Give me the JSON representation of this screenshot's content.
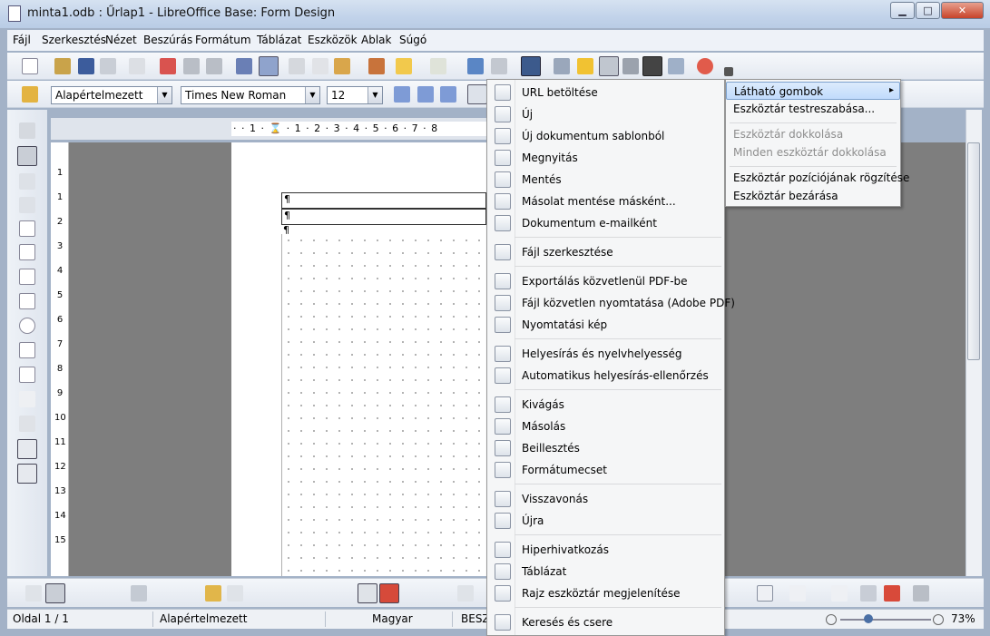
{
  "window": {
    "title": "minta1.odb : Űrlap1 - LibreOffice Base: Form Design",
    "minimize": "▁",
    "maximize": "□",
    "close": "✕"
  },
  "menubar": [
    "Fájl",
    "Szerkesztés",
    "Nézet",
    "Beszúrás",
    "Formátum",
    "Táblázat",
    "Eszközök",
    "Ablak",
    "Súgó"
  ],
  "formatting": {
    "style": "Alapértelmezett",
    "font": "Times New Roman",
    "size": "12"
  },
  "ruler": {
    "h": "· · 1 · ⌛ · 1 · 2 · 3 · 4 · 5 · 6 · 7 · 8",
    "v": [
      "1",
      "1",
      "2",
      "3",
      "4",
      "5",
      "6",
      "7",
      "8",
      "9",
      "10",
      "11",
      "12",
      "13",
      "14",
      "15"
    ]
  },
  "document": {
    "pilcrow": "¶"
  },
  "context_menu": [
    {
      "label": "URL betöltése",
      "icon": "globe-icon"
    },
    {
      "label": "Új",
      "icon": "new-document-icon"
    },
    {
      "label": "Új dokumentum sablonból",
      "icon": "template-icon"
    },
    {
      "label": "Megnyitás",
      "icon": "open-icon"
    },
    {
      "label": "Mentés",
      "icon": "save-icon"
    },
    {
      "label": "Másolat mentése másként...",
      "icon": "save-as-icon"
    },
    {
      "label": "Dokumentum e-mailként",
      "icon": "email-icon"
    },
    {
      "label": "Fájl szerkesztése",
      "icon": "edit-icon"
    },
    {
      "label": "Exportálás közvetlenül PDF-be",
      "icon": "pdf-icon"
    },
    {
      "label": "Fájl közvetlen nyomtatása (Adobe PDF)",
      "icon": "print-icon"
    },
    {
      "label": "Nyomtatási kép",
      "icon": "print-preview-icon"
    },
    {
      "label": "Helyesírás és nyelvhelyesség",
      "icon": "spellcheck-icon"
    },
    {
      "label": "Automatikus helyesírás-ellenőrzés",
      "icon": "autospell-icon"
    },
    {
      "label": "Kivágás",
      "icon": "cut-icon"
    },
    {
      "label": "Másolás",
      "icon": "copy-icon"
    },
    {
      "label": "Beillesztés",
      "icon": "paste-icon"
    },
    {
      "label": "Formátumecset",
      "icon": "format-paintbrush-icon"
    },
    {
      "label": "Visszavonás",
      "icon": "undo-icon"
    },
    {
      "label": "Újra",
      "icon": "redo-icon"
    },
    {
      "label": "Hiperhivatkozás",
      "icon": "hyperlink-icon"
    },
    {
      "label": "Táblázat",
      "icon": "table-icon"
    },
    {
      "label": "Rajz eszköztár megjelenítése",
      "icon": "draw-toolbar-icon"
    },
    {
      "label": "Keresés és csere",
      "icon": "find-replace-icon"
    }
  ],
  "submenu": [
    {
      "label": "Látható gombok",
      "arrow": "▸"
    },
    {
      "label": "Eszköztár testreszabása..."
    },
    {
      "label": "Eszköztár dokkolása"
    },
    {
      "label": "Minden eszköztár dokkolása"
    },
    {
      "label": "Eszköztár pozíciójának rögzítése"
    },
    {
      "label": "Eszköztár bezárása"
    }
  ],
  "statusbar": {
    "page": "Oldal 1 / 1",
    "style": "Alapértelmezett",
    "language": "Magyar",
    "mode": "BESZ",
    "zoom": "73%"
  },
  "colors": {
    "menu_bg": "#f5f6f7",
    "highlight": "#c1dbfc",
    "workspace": "#7e7e7e",
    "titlebar": "#c2d3ea"
  }
}
